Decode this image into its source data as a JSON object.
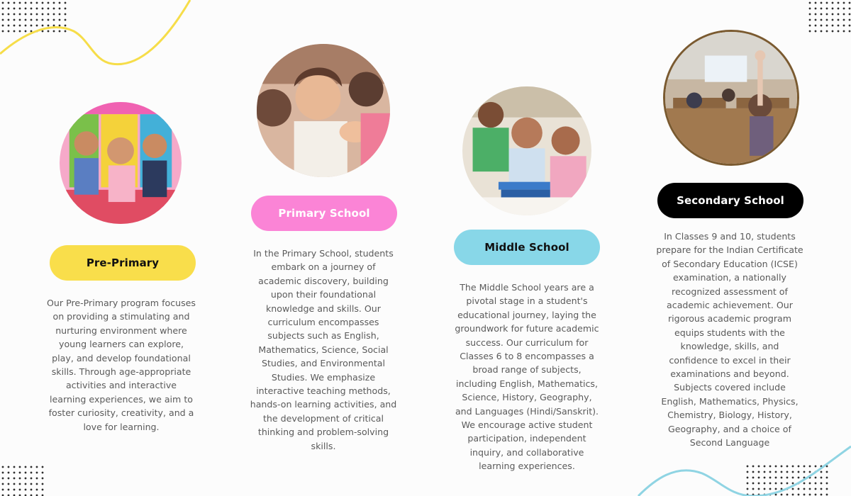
{
  "colors": {
    "pre_primary": "#f9de4b",
    "primary": "#fb84d6",
    "middle": "#88d7e8",
    "secondary": "#000000",
    "deco_yellow": "#f6dd49",
    "deco_blue": "#8fd4e3"
  },
  "levels": [
    {
      "title": "Pre-Primary",
      "description": "Our Pre-Primary program focuses on providing a stimulating and nurturing environment where young learners can explore, play, and develop foundational skills. Through age-appropriate activities and interactive learning experiences, we aim to foster curiosity, creativity, and a love for learning.",
      "photo_icon": "children-photo"
    },
    {
      "title": "Primary School",
      "description": "In the Primary School, students embark on a journey of academic discovery, building upon their foundational knowledge and skills. Our curriculum encompasses subjects such as English, Mathematics, Science, Social Studies, and Environmental Studies. We emphasize interactive teaching methods, hands-on learning activities, and the development of critical thinking and problem-solving skills.",
      "photo_icon": "clapping-child-photo"
    },
    {
      "title": "Middle School",
      "description": "The Middle School years are a pivotal stage in a student's educational journey, laying the groundwork for future academic success. Our curriculum for Classes 6 to 8 encompasses a broad range of subjects, including English, Mathematics, Science, History, Geography, and Languages (Hindi/Sanskrit). We encourage active student participation, independent inquiry, and collaborative learning experiences.",
      "photo_icon": "students-reading-photo"
    },
    {
      "title": "Secondary School",
      "description": "In Classes 9 and 10, students prepare for the Indian Certificate of Secondary Education (ICSE) examination, a nationally recognized assessment of academic achievement. Our rigorous academic program equips students with the knowledge, skills, and confidence to excel in their examinations and beyond. Subjects covered include English, Mathematics, Physics, Chemistry, Biology, History, Geography, and a choice of Second Language",
      "photo_icon": "classroom-photo"
    }
  ]
}
